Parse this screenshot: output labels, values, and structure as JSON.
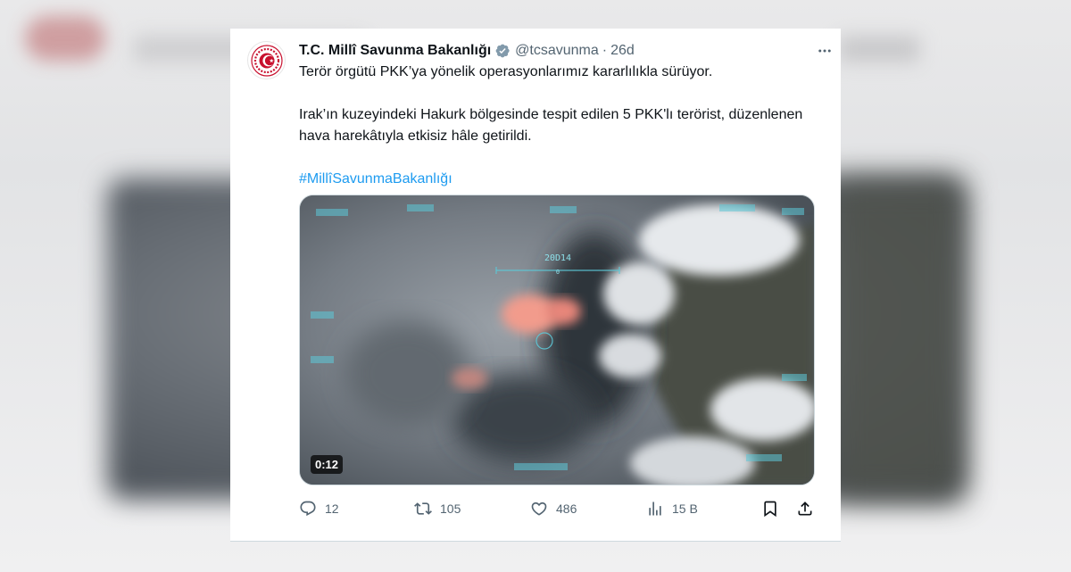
{
  "tweet": {
    "author_name": "T.C. Millî Savunma Bakanlığı",
    "verified_icon": "verified-badge-icon",
    "handle": "@tcsavunma",
    "separator": "·",
    "time": "26d",
    "more_icon": "more-dots-icon",
    "paragraphs": [
      "Terör örgütü PKK’ya yönelik operasyonlarımız kararlılıkla sürüyor.",
      "Irak’ın kuzeyindeki Hakurk bölgesinde tespit edilen 5 PKK'lı terörist, düzenlenen hava harekâtıyla etkisiz hâle getirildi.",
      "#MillîSavunmaBakanlığı"
    ],
    "video": {
      "duration": "0:12",
      "overlay_label": "20D14",
      "overlay_sub": "0"
    },
    "actions": {
      "reply_count": "12",
      "repost_count": "105",
      "like_count": "486",
      "views_count": "15 B"
    },
    "colors": {
      "accent": "#1d9bf0",
      "text": "#0f1419",
      "muted": "#536471",
      "logo_red": "#c8102e"
    }
  }
}
